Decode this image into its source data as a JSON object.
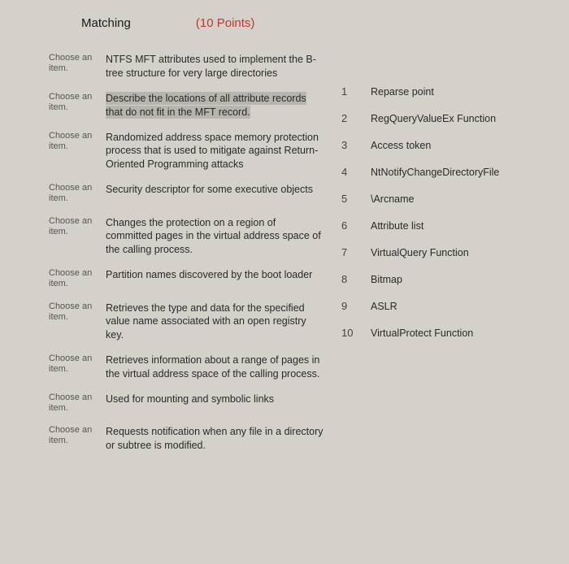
{
  "header": {
    "title": "Matching",
    "points": "(10 Points)"
  },
  "choose_label": "Choose an item.",
  "prompts": [
    {
      "text": "NTFS MFT attributes used to implement the B-tree structure for very large directories",
      "highlighted": false
    },
    {
      "text": "Describe the locations of all attribute records that do not fit in the MFT record.",
      "highlighted": true
    },
    {
      "text": "Randomized address space memory protection process that is used to mitigate against Return-Oriented Programming attacks",
      "highlighted": false
    },
    {
      "text": "Security descriptor for some executive objects",
      "highlighted": false
    },
    {
      "text": "Changes the protection on a region of committed pages in the virtual address space of the calling process.",
      "highlighted": false
    },
    {
      "text": "Partition names discovered by the boot loader",
      "highlighted": false
    },
    {
      "text": "Retrieves the type and data for the specified value name associated with an open registry key.",
      "highlighted": false
    },
    {
      "text": "Retrieves information about a range of pages in the virtual address space of the calling process.",
      "highlighted": false
    },
    {
      "text": "Used for mounting and symbolic links",
      "highlighted": false
    },
    {
      "text": "Requests notification when any file in a directory or subtree is modified.",
      "highlighted": false
    }
  ],
  "answers": [
    {
      "num": "1",
      "text": "Reparse point"
    },
    {
      "num": "2",
      "text": "RegQueryValueEx Function"
    },
    {
      "num": "3",
      "text": "Access token"
    },
    {
      "num": "4",
      "text": "NtNotifyChangeDirectoryFile"
    },
    {
      "num": "5",
      "text": "\\Arcname"
    },
    {
      "num": "6",
      "text": "Attribute list"
    },
    {
      "num": "7",
      "text": "VirtualQuery Function"
    },
    {
      "num": "8",
      "text": "Bitmap"
    },
    {
      "num": "9",
      "text": "ASLR"
    },
    {
      "num": "10",
      "text": "VirtualProtect Function"
    }
  ]
}
